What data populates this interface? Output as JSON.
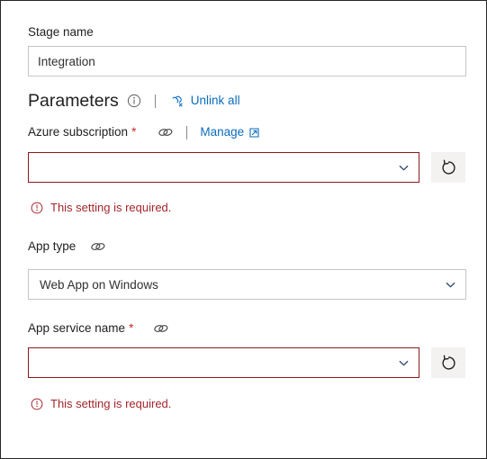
{
  "colors": {
    "link": "#0b6cbe",
    "error_red": "#a4262c",
    "error_border": "#8b1a1a",
    "required_star": "#c02b2b",
    "field_border": "#c8c6c4",
    "button_bg": "#f3f2f1",
    "text": "#201f1e"
  },
  "stage": {
    "label": "Stage name",
    "value": "Integration",
    "placeholder": "Stage name"
  },
  "parameters": {
    "title": "Parameters",
    "info_icon": "info-circle-icon",
    "divider": "|",
    "unlink_all_label": "Unlink all",
    "unlink_all_icon": "unlink-icon"
  },
  "azure_subscription": {
    "label": "Azure subscription",
    "required_marker": "*",
    "link_icon": "link-icon",
    "divider": "|",
    "manage_label": "Manage",
    "manage_icon": "external-link-icon",
    "value": "",
    "placeholder": "",
    "chevron_icon": "chevron-down-icon",
    "refresh_icon": "refresh-icon",
    "error": "This setting is required.",
    "error_icon": "error-circle-icon"
  },
  "app_type": {
    "label": "App type",
    "link_icon": "link-icon",
    "value": "Web App on Windows",
    "chevron_icon": "chevron-down-icon",
    "options": [
      "Web App on Windows"
    ]
  },
  "app_service_name": {
    "label": "App service name",
    "required_marker": "*",
    "link_icon": "link-icon",
    "value": "",
    "placeholder": "",
    "chevron_icon": "chevron-down-icon",
    "refresh_icon": "refresh-icon",
    "error": "This setting is required.",
    "error_icon": "error-circle-icon"
  }
}
